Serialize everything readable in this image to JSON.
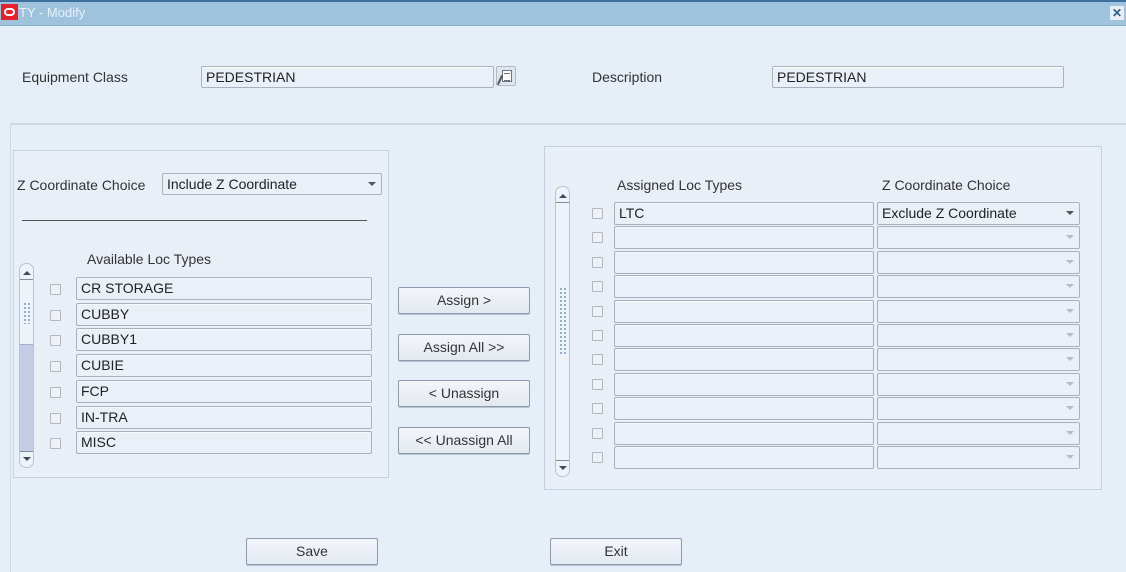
{
  "window": {
    "title": "TY - Modify",
    "logo_icon": "oracle-logo-icon",
    "close_icon": "close-icon",
    "close_glyph": "✕"
  },
  "header": {
    "equipment_class_label": "Equipment Class",
    "equipment_class_value": "PEDESTRIAN",
    "lov_icon": "list-of-values-icon",
    "description_label": "Description",
    "description_value": "PEDESTRIAN"
  },
  "available": {
    "z_choice_label": "Z Coordinate Choice",
    "z_choice_value": "Include Z Coordinate",
    "column_header": "Available Loc Types",
    "rows": [
      {
        "value": "CR STORAGE",
        "checked": false
      },
      {
        "value": "CUBBY",
        "checked": false
      },
      {
        "value": "CUBBY1",
        "checked": false
      },
      {
        "value": "CUBIE",
        "checked": false
      },
      {
        "value": "FCP",
        "checked": false
      },
      {
        "value": "IN-TRA",
        "checked": false
      },
      {
        "value": "MISC",
        "checked": false
      }
    ]
  },
  "actions": {
    "assign": "Assign >",
    "assign_all": "Assign All >>",
    "unassign": "< Unassign",
    "unassign_all": "<< Unassign All"
  },
  "assigned": {
    "column_header_type": "Assigned Loc Types",
    "column_header_choice": "Z Coordinate Choice",
    "rows": [
      {
        "value": "LTC",
        "z_choice": "Exclude Z Coordinate",
        "checked": false
      },
      {
        "value": "",
        "z_choice": "",
        "checked": false
      },
      {
        "value": "",
        "z_choice": "",
        "checked": false
      },
      {
        "value": "",
        "z_choice": "",
        "checked": false
      },
      {
        "value": "",
        "z_choice": "",
        "checked": false
      },
      {
        "value": "",
        "z_choice": "",
        "checked": false
      },
      {
        "value": "",
        "z_choice": "",
        "checked": false
      },
      {
        "value": "",
        "z_choice": "",
        "checked": false
      },
      {
        "value": "",
        "z_choice": "",
        "checked": false
      },
      {
        "value": "",
        "z_choice": "",
        "checked": false
      },
      {
        "value": "",
        "z_choice": "",
        "checked": false
      }
    ]
  },
  "footer": {
    "save": "Save",
    "exit": "Exit"
  }
}
